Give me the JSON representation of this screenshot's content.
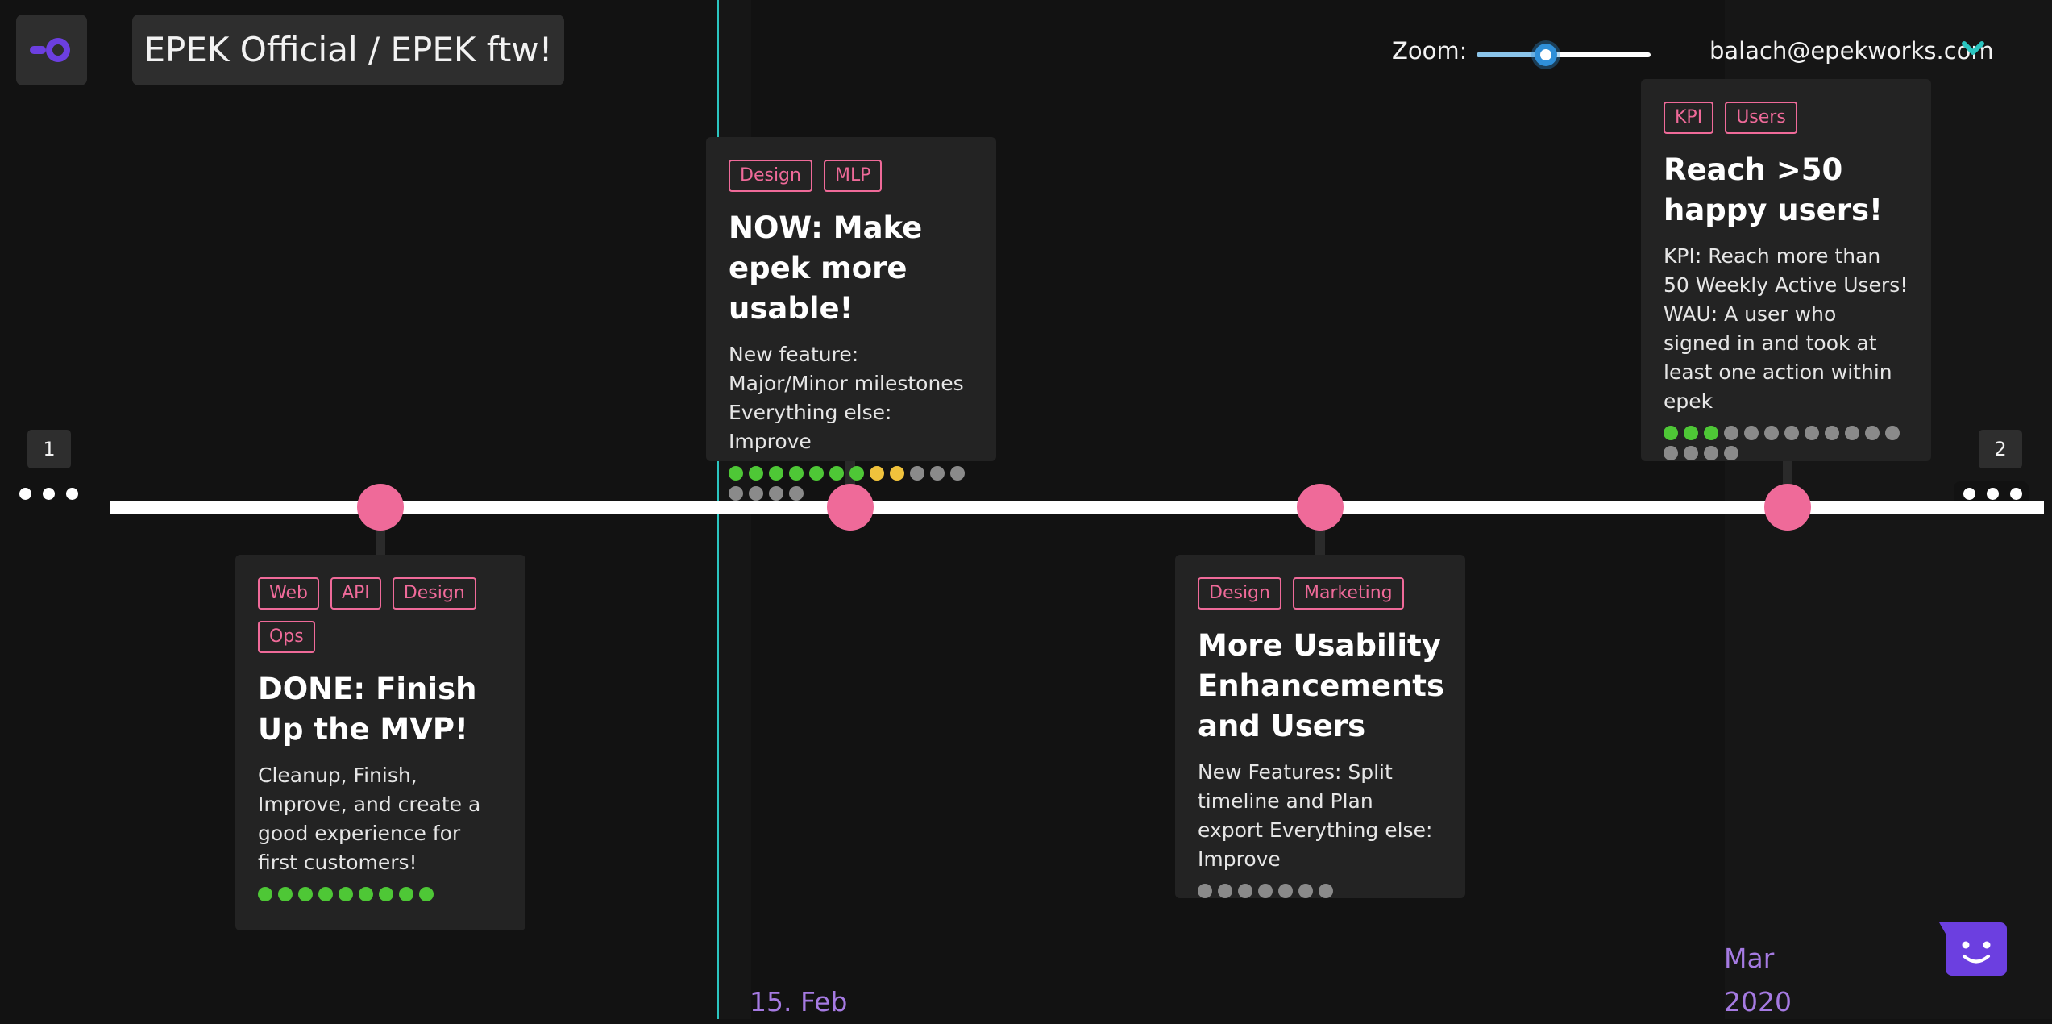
{
  "header": {
    "breadcrumb": "EPEK Official / EPEK ftw!"
  },
  "zoom": {
    "label": "Zoom:",
    "value": 0.4
  },
  "user": {
    "email": "balach@epekworks.com"
  },
  "pagination": {
    "prev_page": "1",
    "next_page": "2"
  },
  "milestones": [
    {
      "tags": [
        "Web",
        "API",
        "Design",
        "Ops"
      ],
      "title": "DONE: Finish Up the MVP!",
      "description": "Cleanup, Finish, Improve, and create a good experience for first customers!",
      "tasks": [
        "done",
        "done",
        "done",
        "done",
        "done",
        "done",
        "done",
        "done",
        "done"
      ]
    },
    {
      "tags": [
        "Design",
        "MLP"
      ],
      "title": "NOW: Make epek more usable!",
      "description": "New feature: Major/Minor milestones Everything else: Improve",
      "tasks": [
        "done",
        "done",
        "done",
        "done",
        "done",
        "done",
        "done",
        "prog",
        "prog",
        "todo",
        "todo",
        "todo",
        "todo",
        "todo",
        "todo",
        "todo"
      ]
    },
    {
      "tags": [
        "Design",
        "Marketing"
      ],
      "title": "More Usability Enhancements and Users",
      "description": "New Features: Split timeline and Plan export Everything else: Improve",
      "tasks": [
        "todo",
        "todo",
        "todo",
        "todo",
        "todo",
        "todo",
        "todo"
      ]
    },
    {
      "tags": [
        "KPI",
        "Users"
      ],
      "title": "Reach >50 happy users!",
      "description": "KPI: Reach more than 50 Weekly Active Users! WAU: A user who signed in and took at least one action within epek",
      "tasks": [
        "done",
        "done",
        "done",
        "todo",
        "todo",
        "todo",
        "todo",
        "todo",
        "todo",
        "todo",
        "todo",
        "todo",
        "todo",
        "todo",
        "todo",
        "todo"
      ]
    }
  ],
  "dates": {
    "feb": "15. Feb",
    "mar_month": "Mar",
    "mar_year": "2020"
  },
  "colors": {
    "accent": "#ef6a99",
    "today": "#2bc5c0",
    "date_text": "#a57ae2",
    "brand": "#6c3fe0",
    "task_done": "#4ec736",
    "task_progress": "#f0c23c",
    "task_todo": "#8a8a8a"
  }
}
